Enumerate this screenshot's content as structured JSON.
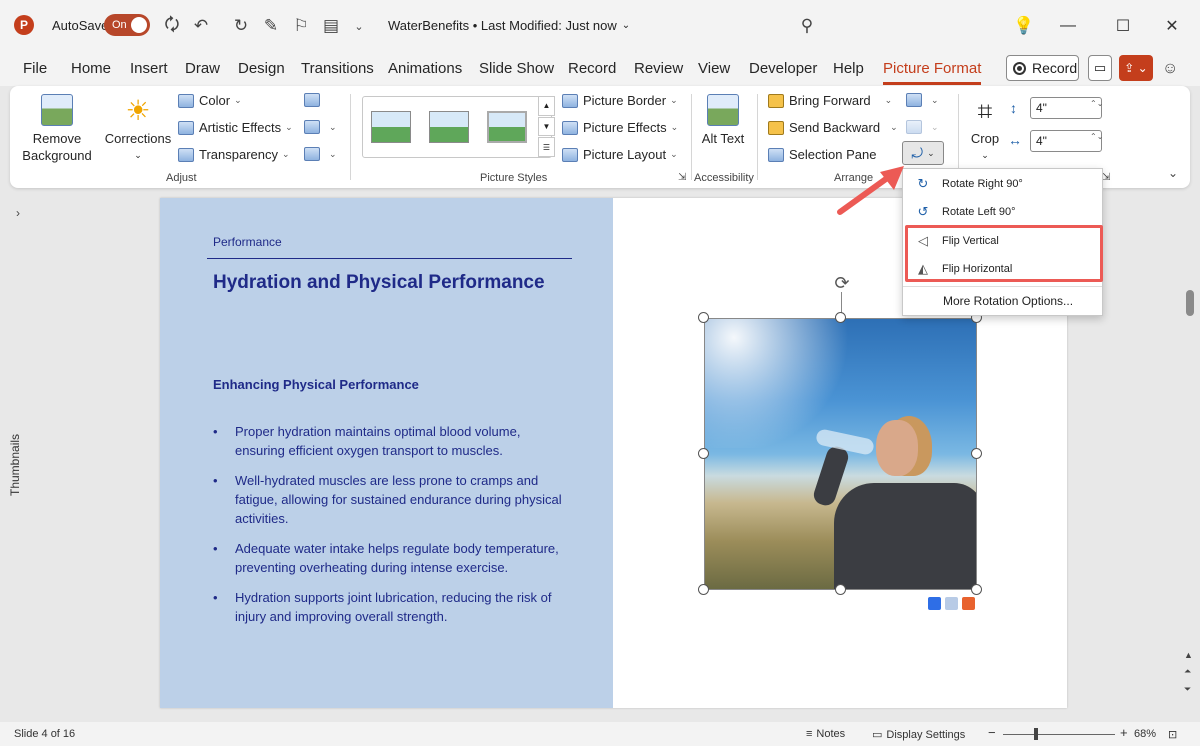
{
  "titlebar": {
    "app_letter": "P",
    "autosave_label": "AutoSave",
    "autosave_state": "On",
    "doc_title": "WaterBenefits • Last Modified: Just now",
    "icons": [
      "save-icon",
      "undo-icon",
      "redo-icon",
      "magic-icon",
      "presentation-icon",
      "customize-icon",
      "search-icon",
      "lightbulb-icon"
    ]
  },
  "tabs": [
    "File",
    "Home",
    "Insert",
    "Draw",
    "Design",
    "Transitions",
    "Animations",
    "Slide Show",
    "Record",
    "Review",
    "View",
    "Developer",
    "Help",
    "Picture Format"
  ],
  "active_tab": "Picture Format",
  "record_label": "Record",
  "ribbon": {
    "remove_background": "Remove Background",
    "corrections": "Corrections",
    "color": "Color",
    "artistic_effects": "Artistic Effects",
    "transparency": "Transparency",
    "adjust_label": "Adjust",
    "picture_border": "Picture Border",
    "picture_effects": "Picture Effects",
    "picture_layout": "Picture Layout",
    "picture_styles_label": "Picture Styles",
    "alt_text": "Alt Text",
    "accessibility_label": "Accessibility",
    "bring_forward": "Bring Forward",
    "send_backward": "Send Backward",
    "selection_pane": "Selection Pane",
    "arrange_label": "Arrange",
    "crop": "Crop",
    "height_value": "4\"",
    "width_value": "4\""
  },
  "thumbnails_label": "Thumbnails",
  "slide": {
    "kicker": "Performance",
    "title": "Hydration and Physical Performance",
    "subheading": "Enhancing Physical Performance",
    "bullets": [
      "Proper hydration maintains optimal blood volume, ensuring efficient oxygen transport to muscles.",
      "Well-hydrated muscles are less prone to cramps and fatigue, allowing for sustained endurance during physical activities.",
      "Adequate water intake helps regulate body temperature, preventing overheating during intense exercise.",
      "Hydration supports joint lubrication, reducing the risk of injury and improving overall strength."
    ]
  },
  "rotate_menu": {
    "rotate_right": "Rotate Right 90°",
    "rotate_left": "Rotate Left 90°",
    "flip_vertical": "Flip Vertical",
    "flip_horizontal": "Flip Horizontal",
    "more_options": "More Rotation Options..."
  },
  "colors": {
    "accent": "#c43e1c",
    "slide_panel": "#bcd0e8",
    "slide_text": "#1f2a88",
    "highlight": "#ec5a55",
    "swatches": [
      "#2e6ee6",
      "#b8cbe6",
      "#e8622e"
    ]
  },
  "status": {
    "slide_info": "Slide 4 of 16",
    "notes": "Notes",
    "display_settings": "Display Settings",
    "zoom": "68%"
  }
}
